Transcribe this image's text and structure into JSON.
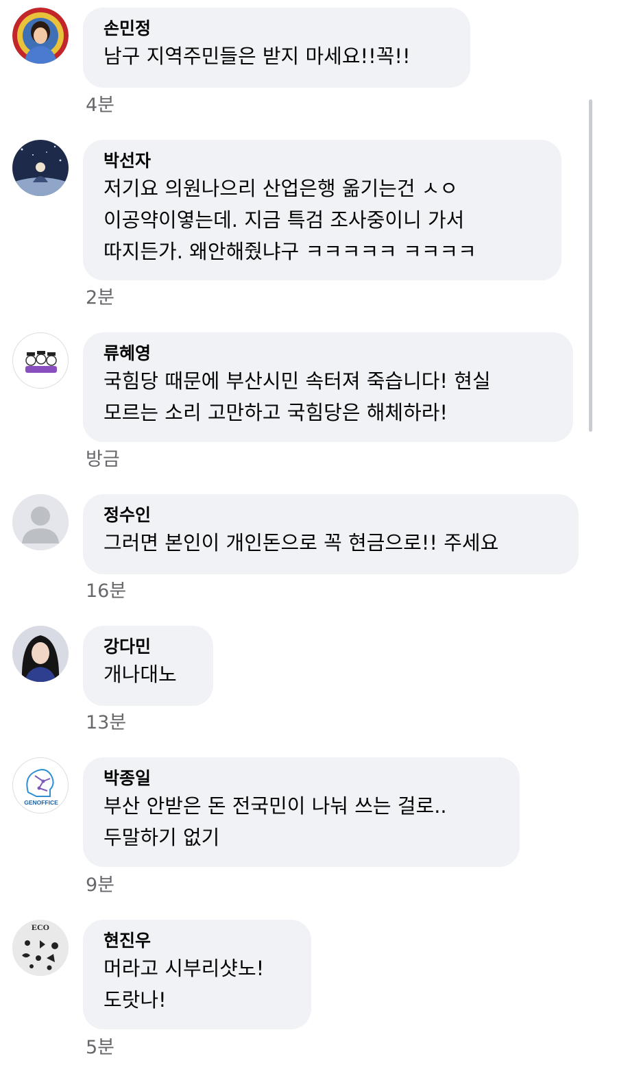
{
  "comments": [
    {
      "author": "손민정",
      "text": "남구 지역주민들은 받지 마세요!!꼭!!",
      "time": "4분",
      "avatar": "person-photo-avatar"
    },
    {
      "author": "박선자",
      "text": "저기요 의원나으리 산업은행 옮기는건 ㅅㅇ\n이공약이옇는데. 지금 특검 조사중이니 가서\n따지든가. 왜안해줬냐구 ㅋㅋㅋㅋㅋ ㅋㅋㅋㅋ",
      "time": "2분",
      "avatar": "night-sky-avatar"
    },
    {
      "author": "류혜영",
      "text": "국힘당 때문에 부산시민 속터져 죽습니다! 현실\n모르는 소리 고만하고 국힘당은 해체하라!",
      "time": "방금",
      "avatar": "cartoon-group-avatar"
    },
    {
      "author": "정수인",
      "text": "그러면 본인이 개인돈으로 꼭 현금으로!! 주세요",
      "time": "16분",
      "avatar": "default-person-avatar"
    },
    {
      "author": "강다민",
      "text": "개나대노",
      "time": "13분",
      "avatar": "person-photo-avatar"
    },
    {
      "author": "박종일",
      "text": "부산 안받은 돈 전국민이 나눠 쓰는 걸로..\n두말하기 없기",
      "time": "9분",
      "avatar": "genoffice-logo-avatar",
      "logo_text": "GENOFFICE"
    },
    {
      "author": "현진우",
      "text": "머라고 시부리샷노!\n도랏나!",
      "time": "5분",
      "avatar": "eco-logo-avatar",
      "logo_text": "ECO"
    }
  ],
  "colors": {
    "bubble": "#f0f2f5",
    "text": "#050505",
    "secondary_text": "#65676b",
    "scrollbar": "#c9ccd1"
  }
}
